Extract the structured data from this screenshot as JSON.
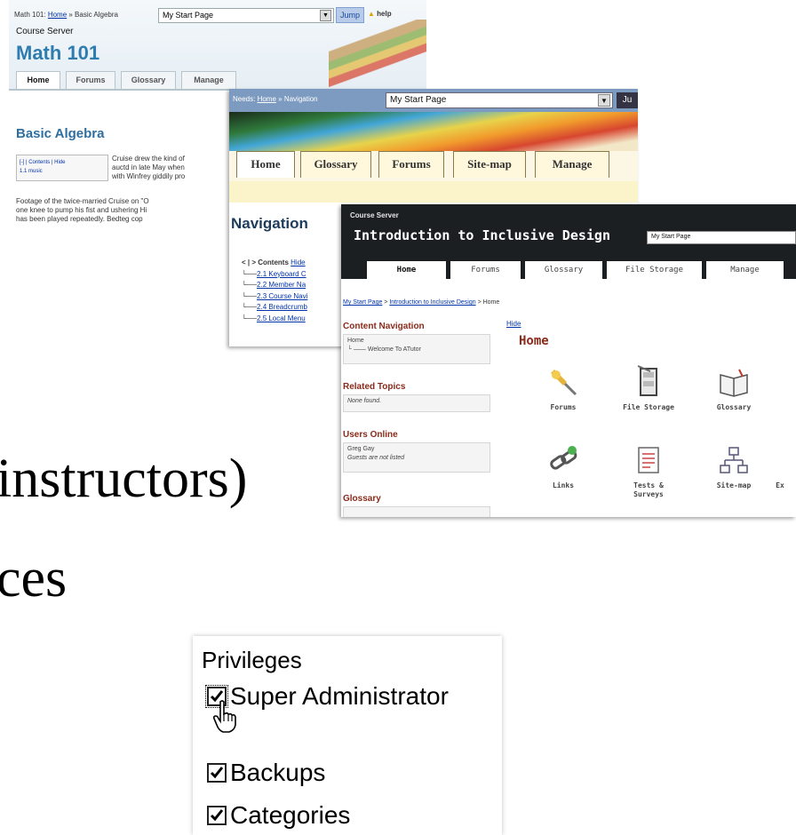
{
  "slide": {
    "line1": "instructors)",
    "line2": "ces"
  },
  "shot1": {
    "breadcrumb_prefix": "Math 101: ",
    "breadcrumb_link": "Home",
    "breadcrumb_suffix": " » Basic Algebra",
    "jump_select": "My Start Page",
    "jump_button": "Jump",
    "help": "help",
    "course_server": "Course Server",
    "title": "Math 101",
    "tabs": [
      "Home",
      "Forums",
      "Glossary",
      "Manage"
    ],
    "heading": "Basic Algebra",
    "toc_line1": "[-] | Contents | Hide",
    "toc_line2": "1.1 music",
    "para_lines": [
      "Cruise drew the kind of",
      "auctd in late May when",
      "with Winfrey giddily pro"
    ],
    "para2_lines": [
      "Footage of the twice-married Cruise on \"O",
      "one knee to pump his fist and ushering Hi",
      "has been played repeatedly. Bedteg cop"
    ]
  },
  "shot2": {
    "breadcrumb_prefix": "Needs: ",
    "breadcrumb_link": "Home",
    "breadcrumb_suffix": " » Navigation",
    "jump_select": "My Start Page",
    "jump_button": "Ju",
    "tabs": [
      "Home",
      "Glossary",
      "Forums",
      "Site-map",
      "Manage"
    ],
    "heading": "Navigation",
    "toc_head": "< | > Contents",
    "toc_hide": "Hide",
    "toc_items": [
      "2.1 Keyboard C",
      "2.2 Member Na",
      "2.3 Course Navi",
      "2.4 Breadcrumb",
      "2.5 Local Menu"
    ]
  },
  "shot3": {
    "course_server": "Course Server",
    "title": "Introduction to Inclusive Design",
    "jump_select": "My Start Page",
    "tabs": [
      "Home",
      "Forums",
      "Glossary",
      "File Storage",
      "Manage"
    ],
    "breadcrumb": [
      "My Start Page",
      "Introduction to Inclusive Design",
      "Home"
    ],
    "hide": "Hide",
    "content_nav": {
      "heading": "Content Navigation",
      "line1": "Home",
      "line2": "Welcome To ATutor"
    },
    "related": {
      "heading": "Related Topics",
      "text": "None found."
    },
    "users_online": {
      "heading": "Users Online",
      "user": "Greg Gay",
      "note": "Guests are not listed"
    },
    "glossary_heading": "Glossary",
    "home_heading": "Home",
    "icons": [
      {
        "label": "Forums",
        "icon": "pushpin-icon"
      },
      {
        "label": "File Storage",
        "icon": "file-cabinet-icon"
      },
      {
        "label": "Glossary",
        "icon": "book-icon"
      },
      {
        "label": "Links",
        "icon": "chain-link-icon"
      },
      {
        "label": "Tests &",
        "label2": "Surveys",
        "icon": "test-sheet-icon"
      },
      {
        "label": "Site-map",
        "icon": "sitemap-icon"
      },
      {
        "label": "Ex",
        "icon": "export-icon"
      }
    ]
  },
  "privileges": {
    "title": "Privileges",
    "items": [
      {
        "label": "Super Administrator",
        "checked": true
      },
      {
        "label": "Backups",
        "checked": true
      },
      {
        "label": "Categories",
        "checked": true
      }
    ],
    "cursor": "hand-pointer-icon"
  }
}
